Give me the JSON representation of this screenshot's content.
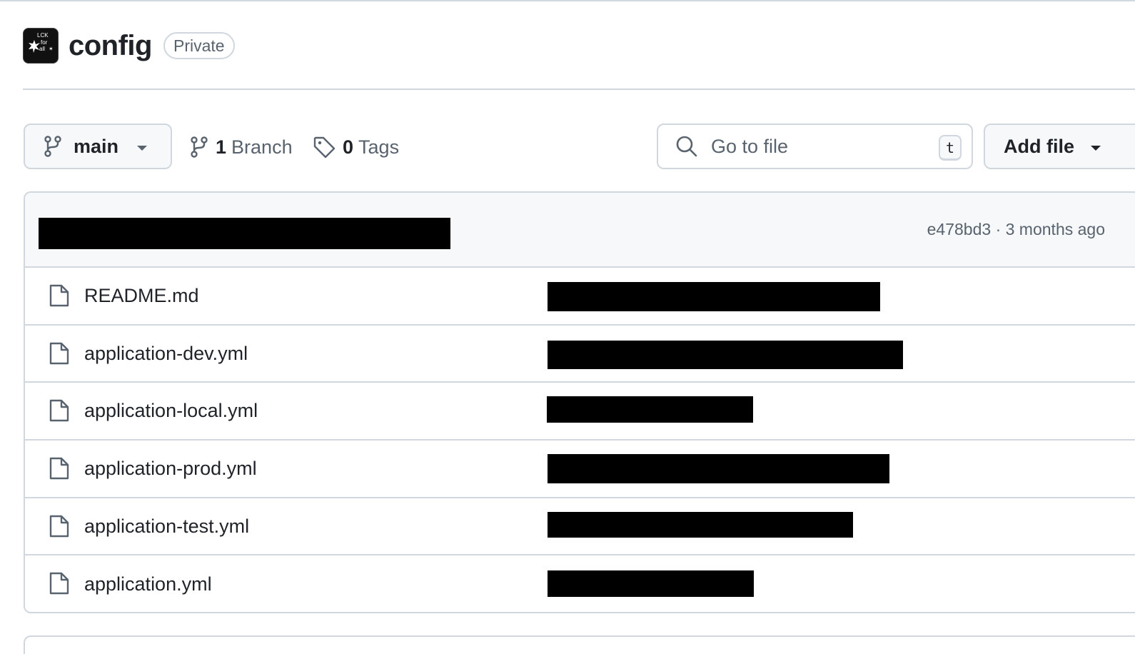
{
  "repo": {
    "name": "config",
    "visibility": "Private",
    "avatar_icon": "org-logo-icon"
  },
  "toolbar": {
    "branch_selector": {
      "label": "main",
      "icon": "git-branch-icon"
    },
    "branches": {
      "count": "1",
      "label": "Branch"
    },
    "tags": {
      "count": "0",
      "label": "Tags"
    },
    "search": {
      "placeholder": "Go to file",
      "shortcut": "t"
    },
    "add_file": {
      "label": "Add file"
    }
  },
  "latest_commit": {
    "message": "",
    "hash": "e478bd3",
    "separator": "·",
    "age": "3 months ago"
  },
  "files": [
    {
      "name": "README.md",
      "icon": "file-icon"
    },
    {
      "name": "application-dev.yml",
      "icon": "file-icon"
    },
    {
      "name": "application-local.yml",
      "icon": "file-icon"
    },
    {
      "name": "application-prod.yml",
      "icon": "file-icon"
    },
    {
      "name": "application-test.yml",
      "icon": "file-icon"
    },
    {
      "name": "application.yml",
      "icon": "file-icon"
    }
  ],
  "colors": {
    "border": "#d0d7de",
    "muted_text": "#59636e",
    "header_bg": "#f6f8fa",
    "redaction": "#000000"
  }
}
